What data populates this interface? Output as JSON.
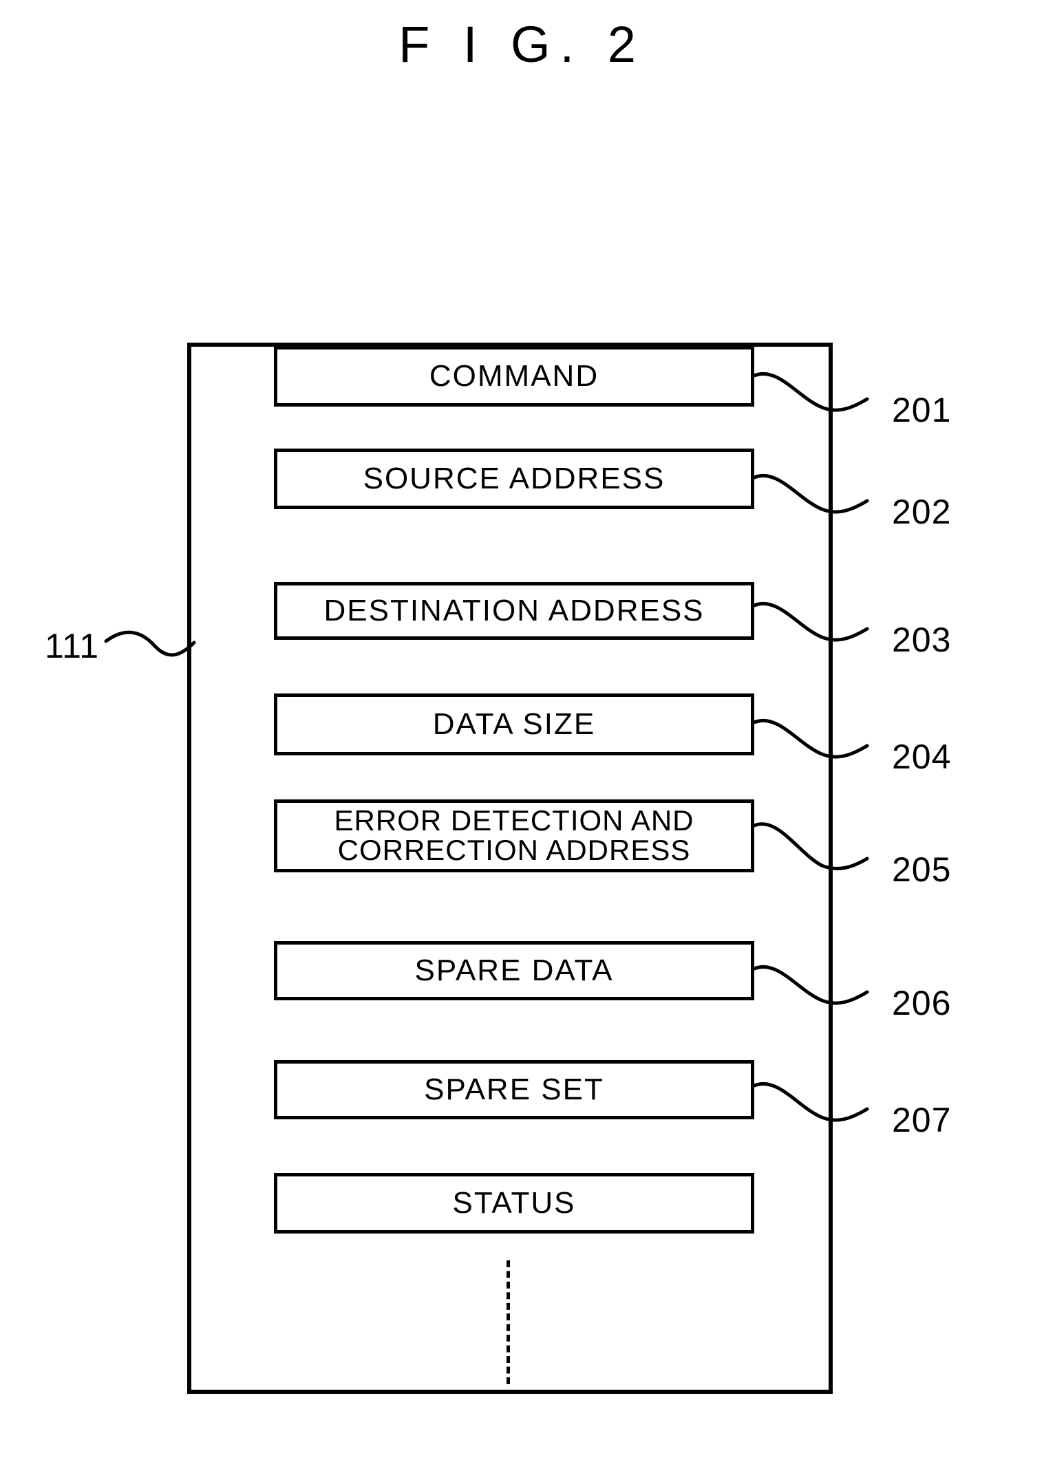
{
  "figure": {
    "title": "F I G. 2",
    "outer_ref": "111"
  },
  "fields": [
    {
      "label": "COMMAND",
      "ref": "201",
      "lines": 1
    },
    {
      "label": "SOURCE ADDRESS",
      "ref": "202",
      "lines": 1
    },
    {
      "label": "DESTINATION ADDRESS",
      "ref": "203",
      "lines": 1
    },
    {
      "label": "DATA SIZE",
      "ref": "204",
      "lines": 1
    },
    {
      "label": "ERROR DETECTION AND\nCORRECTION ADDRESS",
      "ref": "205",
      "lines": 2
    },
    {
      "label": "SPARE DATA",
      "ref": "206",
      "lines": 1
    },
    {
      "label": "SPARE SET",
      "ref": "207",
      "lines": 1
    },
    {
      "label": "STATUS",
      "ref": "",
      "lines": 1
    }
  ],
  "continuation": {
    "style": "vertical-dashed-line"
  }
}
